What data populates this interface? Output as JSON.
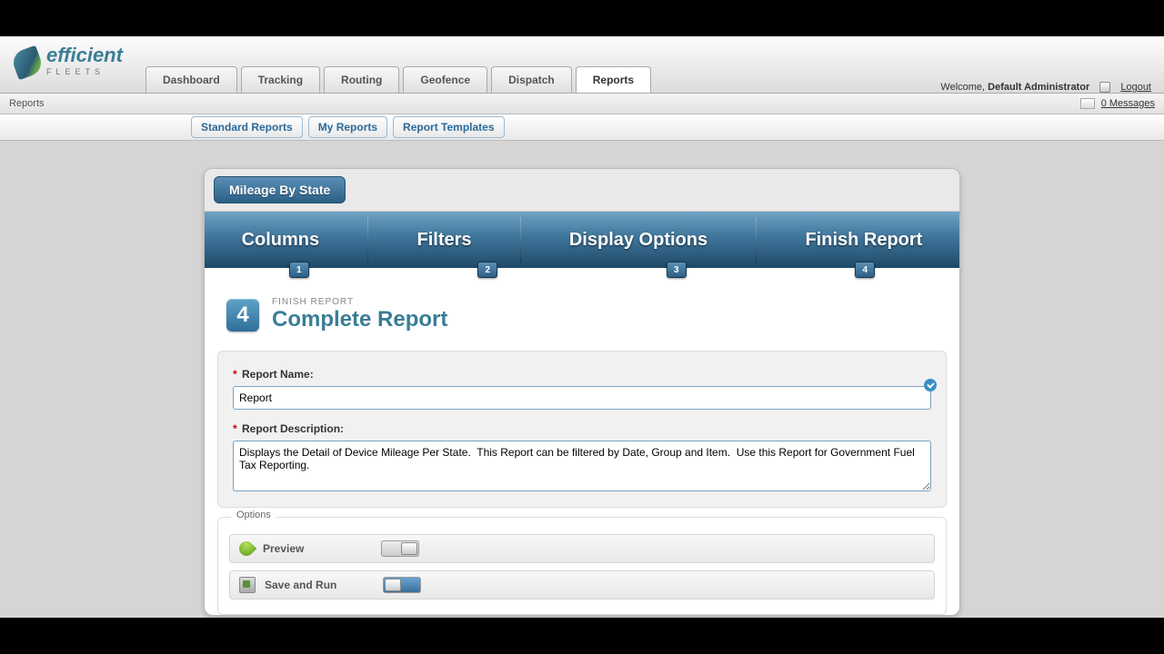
{
  "brand": {
    "name": "efficient",
    "sub": "FLEETS"
  },
  "nav": {
    "tabs": [
      "Dashboard",
      "Tracking",
      "Routing",
      "Geofence",
      "Dispatch",
      "Reports"
    ],
    "active_index": 5
  },
  "header_right": {
    "welcome_prefix": "Welcome,",
    "user": "Default Administrator",
    "logout": "Logout"
  },
  "crumb": {
    "label": "Reports"
  },
  "messages": {
    "count_label": "0 Messages"
  },
  "subtabs": [
    "Standard Reports",
    "My Reports",
    "Report Templates"
  ],
  "card": {
    "title": "Mileage By State"
  },
  "wizard": {
    "steps": [
      "Columns",
      "Filters",
      "Display Options",
      "Finish Report"
    ],
    "numbers": [
      "1",
      "2",
      "3",
      "4"
    ],
    "current": 4
  },
  "step": {
    "number": "4",
    "kicker": "FINISH REPORT",
    "title": "Complete Report"
  },
  "form": {
    "name_label": "Report Name:",
    "name_value": "Report",
    "desc_label": "Report Description:",
    "desc_value": "Displays the Detail of Device Mileage Per State.  This Report can be filtered by Date, Group and Item.  Use this Report for Government Fuel Tax Reporting."
  },
  "options": {
    "legend": "Options",
    "rows": [
      {
        "icon": "preview",
        "label": "Preview",
        "state": "off"
      },
      {
        "icon": "saverun",
        "label": "Save and Run",
        "state": "on"
      }
    ]
  }
}
